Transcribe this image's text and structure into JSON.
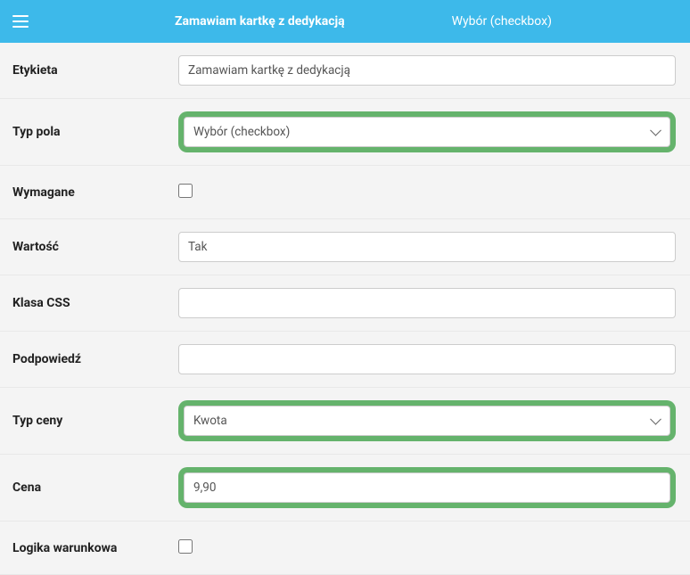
{
  "header": {
    "title": "Zamawiam kartkę z dedykacją",
    "subtitle": "Wybór (checkbox)"
  },
  "labels": {
    "etykieta": "Etykieta",
    "typ_pola": "Typ pola",
    "wymagane": "Wymagane",
    "wartosc": "Wartość",
    "klasa_css": "Klasa CSS",
    "podpowiedz": "Podpowiedź",
    "typ_ceny": "Typ ceny",
    "cena": "Cena",
    "logika": "Logika warunkowa"
  },
  "values": {
    "etykieta": "Zamawiam kartkę z dedykacją",
    "typ_pola": "Wybór (checkbox)",
    "wymagane": false,
    "wartosc": "Tak",
    "klasa_css": "",
    "podpowiedz": "",
    "typ_ceny": "Kwota",
    "cena": "9,90",
    "logika": false
  }
}
